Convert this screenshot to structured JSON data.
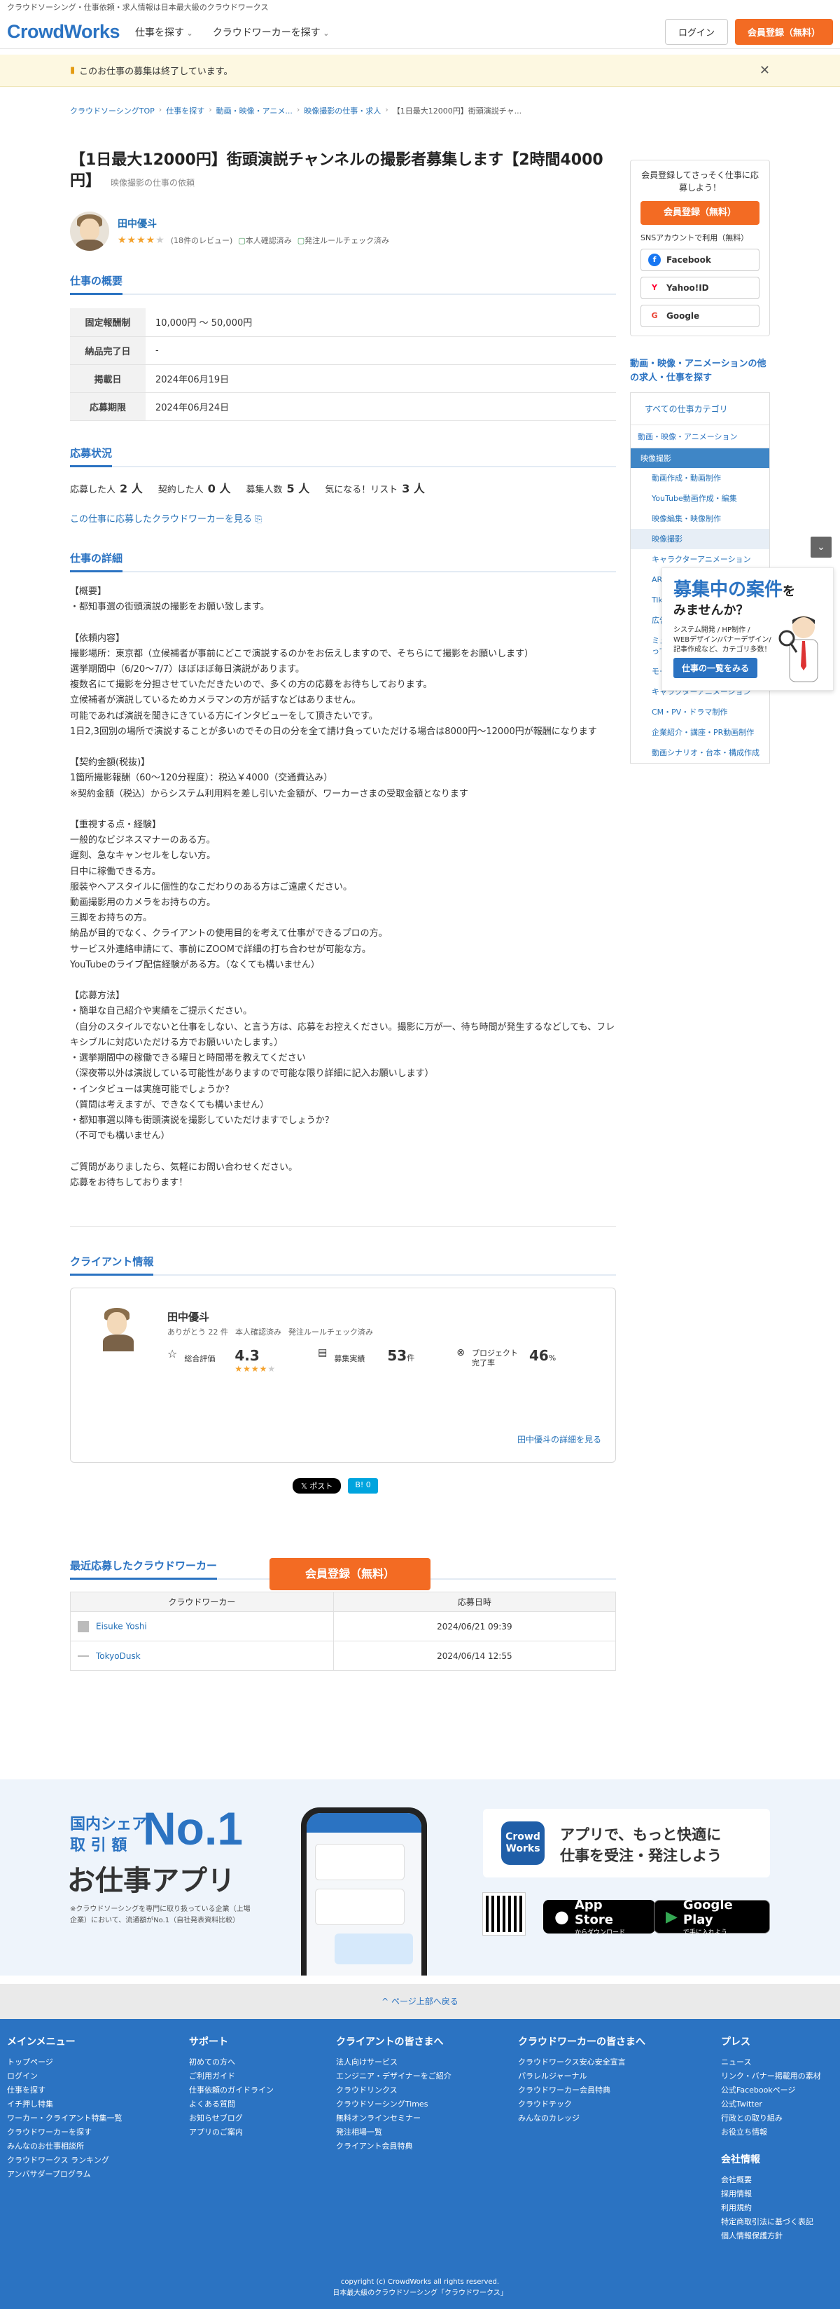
{
  "top_strip": "クラウドソーシング・仕事依頼・求人情報は日本最大級のクラウドワークス",
  "header": {
    "logo": "CrowdWorks",
    "nav": [
      "仕事を探す",
      "クラウドワーカーを探す"
    ],
    "login": "ログイン",
    "register": "会員登録（無料）"
  },
  "notice": {
    "icon": "warning-icon",
    "text": "このお仕事の募集は終了しています。",
    "close": "✕"
  },
  "breadcrumbs": [
    "クラウドソーシングTOP",
    "仕事を探す",
    "動画・映像・アニメ...",
    "映像撮影の仕事・求人",
    "【1日最大12000円】街頭演説チャ..."
  ],
  "job": {
    "title": "【1日最大12000円】街頭演説チャンネルの撮影者募集します【2時間4000円】",
    "category": "映像撮影の仕事の依頼",
    "client_name": "田中優斗",
    "rating": 4,
    "reviews": "(18件のレビュー)",
    "badges": [
      "本人確認済み",
      "発注ルールチェック済み"
    ]
  },
  "summary": {
    "heading": "仕事の概要",
    "rows": [
      {
        "k": "固定報酬制",
        "v": "10,000円 〜 50,000円"
      },
      {
        "k": "納品完了日",
        "v": "-"
      },
      {
        "k": "掲載日",
        "v": "2024年06月19日"
      },
      {
        "k": "応募期限",
        "v": "2024年06月24日"
      }
    ]
  },
  "status": {
    "heading": "応募状況",
    "items": [
      {
        "label": "応募した人",
        "value": "2 人"
      },
      {
        "label": "契約した人",
        "value": "0 人"
      },
      {
        "label": "募集人数",
        "value": "5 人"
      },
      {
        "label": "気になる！リスト",
        "value": "3 人"
      }
    ],
    "link": "この仕事に応募したクラウドワーカーを見る ⎘"
  },
  "details": {
    "heading": "仕事の詳細",
    "text": "【概要】\n・都知事選の街頭演説の撮影をお願い致します。\n\n【依頼内容】\n撮影場所：東京都（立候補者が事前にどこで演説するのかをお伝えしますので、そちらにて撮影をお願いします）\n選挙期間中（6/20〜7/7）ほぼほぼ毎日演説があります。\n複数名にて撮影を分担させていただきたいので、多くの方の応募をお待ちしております。\n立候補者が演説しているためカメラマンの方が話すなどはありません。\n可能であれば演説を聞きにきている方にインタビューをして頂きたいです。\n1日2,3回別の場所で演説することが多いのでその日の分を全て請け負っていただける場合は8000円〜12000円が報酬になります\n\n【契約金額(税抜)】\n1箇所撮影報酬（60〜120分程度）：税込￥4000（交通費込み）\n※契約金額（税込）からシステム利用料を差し引いた金額が、ワーカーさまの受取金額となります\n\n【重視する点・経験】\n一般的なビジネスマナーのある方。\n遅刻、急なキャンセルをしない方。\n日中に稼働できる方。\n服装やヘアスタイルに個性的なこだわりのある方はご遠慮ください。\n動画撮影用のカメラをお持ちの方。\n三脚をお持ちの方。\n納品が目的でなく、クライアントの使用目的を考えて仕事ができるプロの方。\nサービス外連絡申請にて、事前にZOOMで詳細の打ち合わせが可能な方。\nYouTubeのライブ配信経験がある方。（なくても構いません）\n\n【応募方法】\n・簡単な自己紹介や実績をご提示ください。\n（自分のスタイルでないと仕事をしない、と言う方は、応募をお控えください。撮影に万が一、待ち時間が発生するなどしても、フレキシブルに対応いただける方でお願いいたします。）\n・選挙期間中の稼働できる曜日と時間帯を教えてください\n（深夜帯以外は演説している可能性がありますので可能な限り詳細に記入お願いします）\n・インタビューは実施可能でしょうか？\n（質問は考えますが、できなくても構いません）\n・都知事選以降も街頭演説を撮影していただけますでしょうか？\n（不可でも構いません）\n\nご質問がありましたら、気軽にお問い合わせください。\n応募をお待ちしております！"
  },
  "client": {
    "heading": "クライアント情報",
    "name": "田中優斗",
    "meta": [
      "ありがとう 22 件",
      "本人確認済み",
      "発注ルールチェック済み"
    ],
    "stats": [
      {
        "label": "総合評価",
        "value": "4.3",
        "unit": "",
        "icon": "star-outline-icon"
      },
      {
        "label": "募集実績",
        "value": "53",
        "unit": "件",
        "icon": "document-icon"
      },
      {
        "label": "プロジェクト完了率",
        "value": "46",
        "unit": "%",
        "icon": "handshake-icon"
      }
    ],
    "rating": 4.3,
    "more": "田中優斗の詳細を見る"
  },
  "share": {
    "x": "𝕏 ポスト",
    "hatena": "B! 0"
  },
  "recent": {
    "heading": "最近応募したクラウドワーカー",
    "columns": [
      "クラウドワーカー",
      "応募日時"
    ],
    "rows": [
      {
        "name": "Eisuke Yoshi",
        "date": "2024/06/21 09:39"
      },
      {
        "name": "TokyoDusk",
        "date": "2024/06/14 12:55"
      }
    ]
  },
  "cta": "会員登録（無料）",
  "sidebar": {
    "reg_text": "会員登録してさっそく仕事に応募しよう！",
    "reg_btn": "会員登録（無料）",
    "sns_text": "SNSアカウントで利用（無料）",
    "sns": [
      {
        "label": "Facebook",
        "color": "#1877f2",
        "glyph": "f"
      },
      {
        "label": "Yahoo!ID",
        "color": "#ff0033",
        "glyph": "Y"
      },
      {
        "label": "Google",
        "color": "#ea4335",
        "glyph": "G"
      }
    ],
    "cat_heading": "動画・映像・アニメーションの他の求人・仕事を探す",
    "all": "すべての仕事カテゴリ",
    "group": "動画・映像・アニメーション",
    "selected": "映像撮影",
    "items": [
      "動画作成・動画制作",
      "YouTube動画作成・編集",
      "映像編集・映像制作",
      "映像撮影",
      "キャラクターアニメーション",
      "AR・VR・3D映像制作",
      "TikTok動画作成",
      "広告動画作成",
      "ミュージックビデオ（MV）・歌ってみた動画",
      "モーショングラフィックス",
      "キャラクターアニメーション",
      "CM・PV・ドラマ制作",
      "企業紹介・講座・PR動画制作",
      "動画シナリオ・台本・構成作成"
    ]
  },
  "float_ad": {
    "h1": "募集中の案件",
    "h1_suffix": "を",
    "h2": "みませんか？",
    "small": "システム開発 / HP制作 /\nWEBデザイン/バナーデザイン/\n記事作成など、カテゴリ多数！",
    "btn": "仕事の一覧をみる",
    "toggle": "⌄"
  },
  "app": {
    "t1": "国内シェア\n取 引 額",
    "no1": "No.1",
    "t2": "お仕事アプリ",
    "note": "※クラウドソーシングを専門に取り扱っている企業（上場企業）において、流通額がNo.1（自社発表資料比較）",
    "icon": "Crowd\nWorks",
    "card": "アプリで、もっと快適に\n仕事を受注・発注しよう",
    "appstore": "App Store",
    "appstore_sub": "からダウンロード",
    "gplay": "Google Play",
    "gplay_sub": "で手に入れよう"
  },
  "backtop": "^ ページ上部へ戻る",
  "footer": {
    "cols": [
      {
        "h": "メインメニュー",
        "items": [
          "トップページ",
          "ログイン",
          "仕事を探す",
          "イチ押し特集",
          "ワーカー・クライアント特集一覧",
          "クラウドワーカーを探す",
          "みんなのお仕事相談所",
          "クラウドワークス ランキング",
          "アンバサダープログラム"
        ]
      },
      {
        "h": "サポート",
        "items": [
          "初めての方へ",
          "ご利用ガイド",
          "仕事依頼のガイドライン",
          "よくある質問",
          "お知らせブログ",
          "アプリのご案内"
        ]
      },
      {
        "h": "クライアントの皆さまへ",
        "items": [
          "法人向けサービス",
          "エンジニア・デザイナーをご紹介",
          "クラウドリンクス",
          "クラウドソーシングTimes",
          "無料オンラインセミナー",
          "発注相場一覧",
          "クライアント会員特典"
        ]
      },
      {
        "h": "クラウドワーカーの皆さまへ",
        "items": [
          "クラウドワークス安心安全宣言",
          "パラレルジャーナル",
          "クラウドワーカー会員特典",
          "クラウドテック",
          "みんなのカレッジ"
        ]
      },
      {
        "h": "プレス",
        "items": [
          "ニュース",
          "リンク・バナー掲載用の素材",
          "公式Facebookページ",
          "公式Twitter",
          "行政との取り組み",
          "お役立ち情報"
        ]
      }
    ],
    "company_h": "会社情報",
    "company": [
      "会社概要",
      "採用情報",
      "利用規約",
      "特定商取引法に基づく表記",
      "個人情報保護方針"
    ],
    "copy1": "copyright (c) CrowdWorks all rights reserved.",
    "copy2": "日本最大級のクラウドソーシング「クラウドワークス」"
  }
}
